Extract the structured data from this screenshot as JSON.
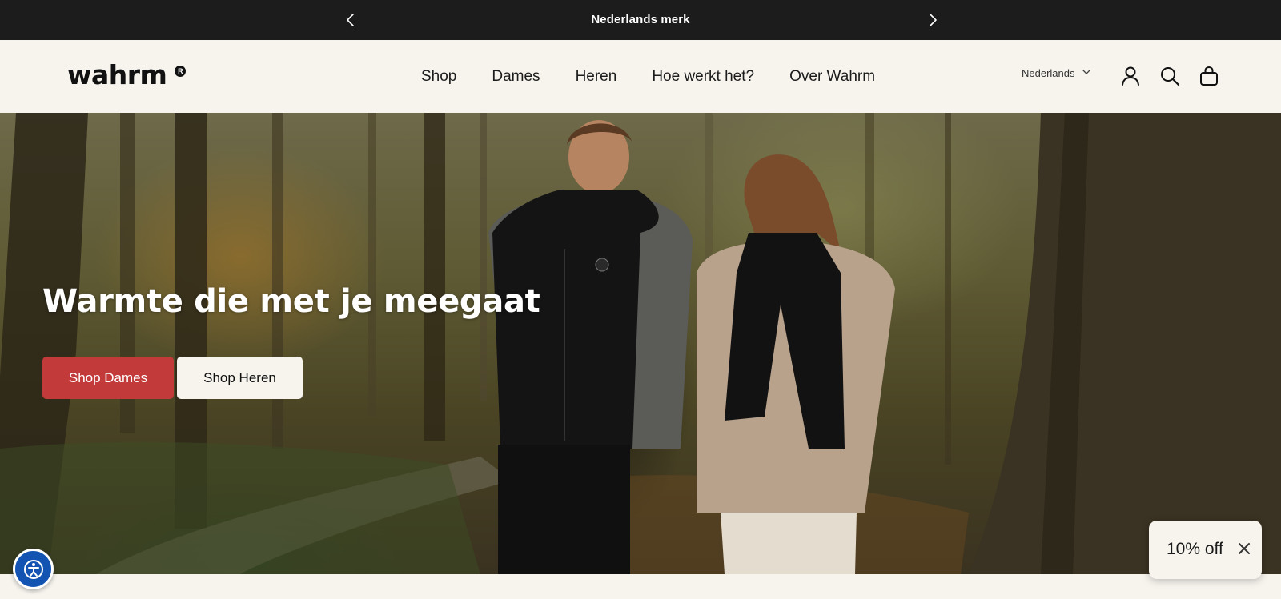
{
  "announcement": {
    "message": "Nederlands merk",
    "prev_icon": "chevron-left-icon",
    "next_icon": "chevron-right-icon"
  },
  "header": {
    "logo_text": "wahrm",
    "logo_mark": "R",
    "nav": [
      "Shop",
      "Dames",
      "Heren",
      "Hoe werkt het?",
      "Over Wahrm"
    ],
    "language": "Nederlands",
    "icons": [
      "chevron-down-icon",
      "account-icon",
      "search-icon",
      "cart-icon"
    ]
  },
  "hero": {
    "headline": "Warmte die met je meegaat",
    "buttons": {
      "dames": "Shop Dames",
      "heren": "Shop Heren"
    }
  },
  "discount": {
    "label": "10% off",
    "close_icon": "close-icon"
  },
  "accessibility": {
    "icon": "accessibility-icon"
  },
  "colors": {
    "announcement_bg": "#1c1c1c",
    "page_bg": "#f7f4ee",
    "accent_red": "#c23a3a",
    "a11y_blue": "#1354b3"
  }
}
